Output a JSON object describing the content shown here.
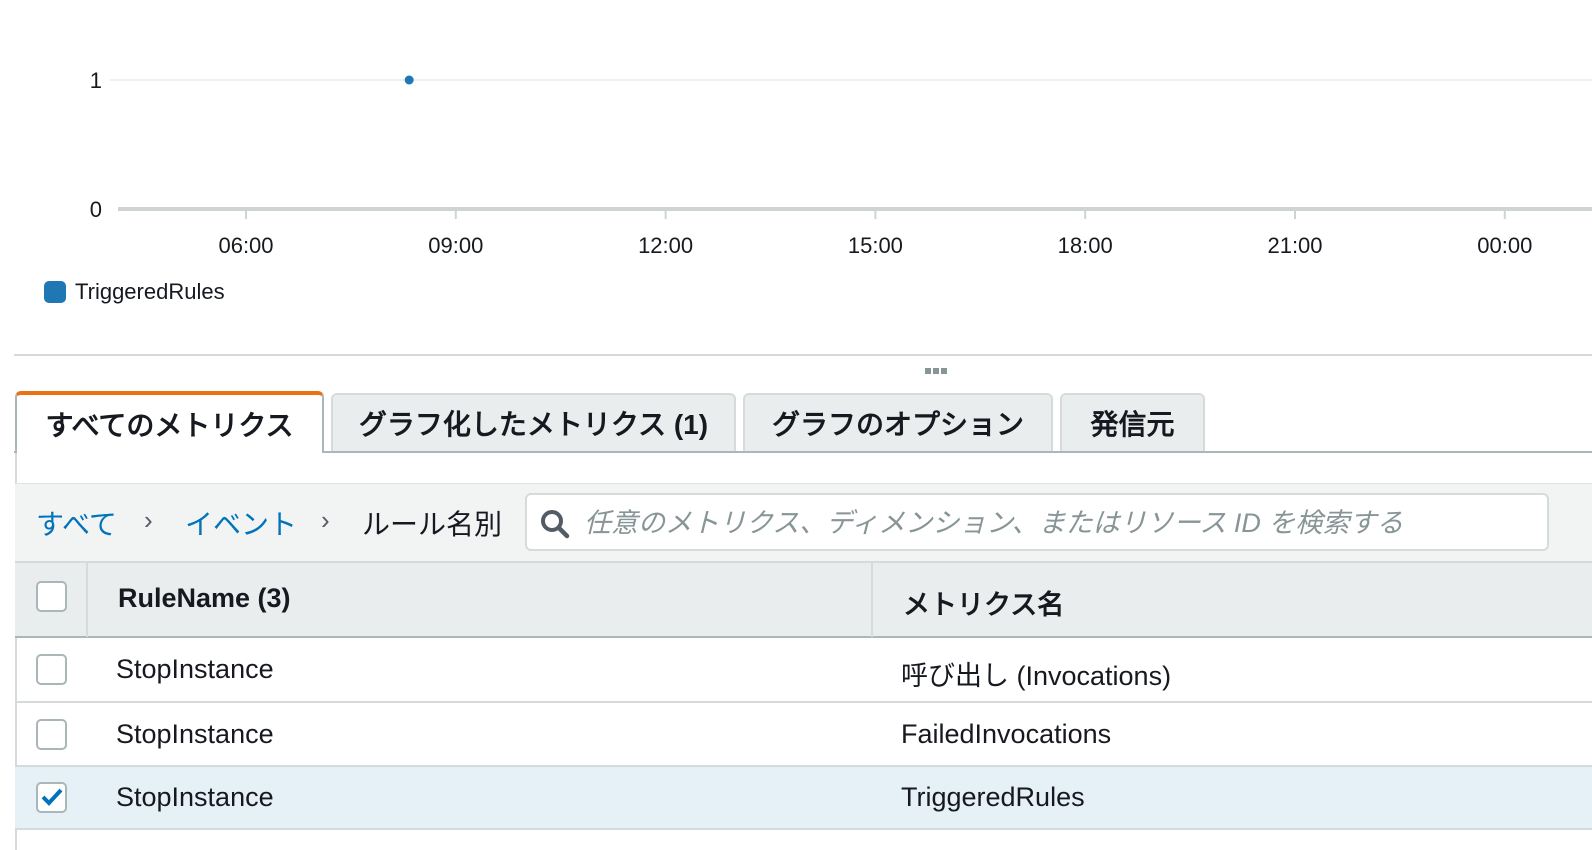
{
  "chart_data": {
    "type": "scatter",
    "x_ticks": [
      "06:00",
      "09:00",
      "12:00",
      "15:00",
      "18:00",
      "21:00",
      "00:00"
    ],
    "y_ticks": [
      "0",
      "1"
    ],
    "ylim": [
      0,
      1
    ],
    "series": [
      {
        "name": "TriggeredRules",
        "color": "#1f77b4",
        "points": [
          {
            "x": "08:20",
            "y": 1
          }
        ]
      }
    ],
    "legend": "bottom-left",
    "grid": true
  },
  "tabs": [
    {
      "label": "すべてのメトリクス",
      "active": true
    },
    {
      "label": "グラフ化したメトリクス (1)",
      "active": false
    },
    {
      "label": "グラフのオプション",
      "active": false
    },
    {
      "label": "発信元",
      "active": false
    }
  ],
  "breadcrumb": {
    "items": [
      "すべて",
      "イベント",
      "ルール名別"
    ],
    "separator": "›"
  },
  "search": {
    "placeholder": "任意のメトリクス、ディメンション、またはリソース ID を検索する",
    "value": ""
  },
  "table": {
    "columns": [
      "RuleName (3)",
      "メトリクス名"
    ],
    "rows": [
      {
        "rule": "StopInstance",
        "metric": "呼び出し (Invocations)",
        "checked": false
      },
      {
        "rule": "StopInstance",
        "metric": "FailedInvocations",
        "checked": false
      },
      {
        "rule": "StopInstance",
        "metric": "TriggeredRules",
        "checked": true
      }
    ]
  },
  "colors": {
    "accent": "#ec7211",
    "link": "#0073bb",
    "series": "#1f77b4",
    "selected_row": "#e6f0f7"
  }
}
